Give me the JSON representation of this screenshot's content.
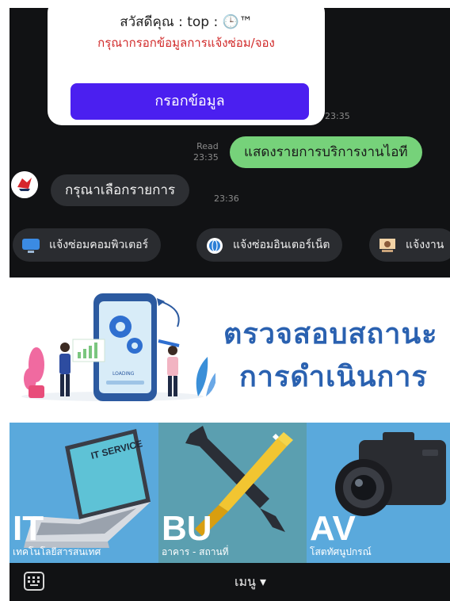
{
  "card": {
    "greeting": "สวัสดีคุณ : top : 🕒™",
    "instruction": "กรุณากรอกข้อมูลการแจ้งซ่อม/จอง",
    "button_label": "กรอกข้อมูล",
    "time": "23:35"
  },
  "outgoing": {
    "status": "Read",
    "time": "23:35",
    "text": "แสดงรายการบริการงานไอที"
  },
  "incoming": {
    "text": "กรุณาเลือกรายการ",
    "time": "23:36"
  },
  "quick_replies": [
    {
      "label": "แจ้งซ่อมคอมพิวเตอร์",
      "icon": "computer-icon"
    },
    {
      "label": "แจ้งซ่อมอินเตอร์เน็ต",
      "icon": "globe-icon"
    },
    {
      "label": "แจ้งงาน",
      "icon": "presentation-icon"
    }
  ],
  "banner": {
    "line1": "ตรวจสอบสถานะ",
    "line2": "การดำเนินการ",
    "phone_label": "LOADING"
  },
  "tiles": [
    {
      "code": "IT",
      "label": "เทคโนโลยีสารสนเทศ",
      "badge": "IT SERVICE",
      "color": "#5aa9dc"
    },
    {
      "code": "BU",
      "label": "อาคาร - สถานที่",
      "color": "#5b9fb0"
    },
    {
      "code": "AV",
      "label": "โสตทัศนูปกรณ์",
      "color": "#5aa9dc"
    }
  ],
  "bottom_bar": {
    "menu_label": "เมนู ▾"
  },
  "colors": {
    "chat_bg": "#111214",
    "primary_button": "#4b1ff0",
    "outgoing_bubble": "#76d27a",
    "incoming_bubble": "#2d2f33",
    "banner_text": "#2a61b0"
  }
}
